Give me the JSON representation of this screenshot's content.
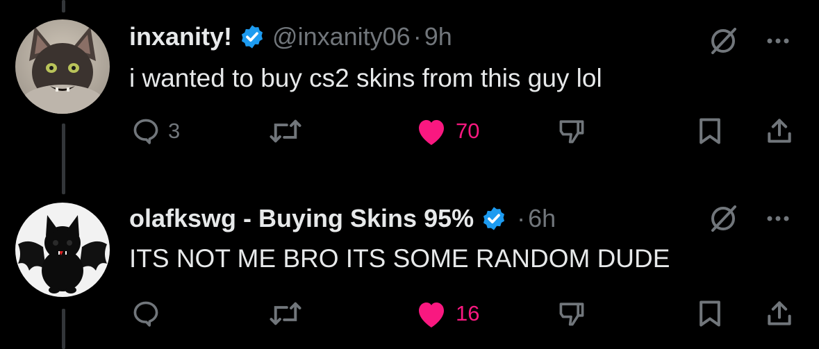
{
  "posts": [
    {
      "display_name": "inxanity!",
      "verified": true,
      "handle": "@inxanity06",
      "separator": "·",
      "time": "9h",
      "text": "i wanted to buy cs2 skins from this guy lol",
      "avatar": "hairless-cat-avatar",
      "actions": {
        "reply_count": "3",
        "retweet_count": "",
        "like_count": "70",
        "liked": true
      }
    },
    {
      "display_name": "olafkswg - Buying Skins 95%",
      "verified": true,
      "handle": "",
      "separator": "·",
      "time": "6h",
      "text": "ITS NOT ME BRO ITS SOME RANDOM DUDE",
      "avatar": "black-cat-bat-wings-avatar",
      "actions": {
        "reply_count": "",
        "retweet_count": "",
        "like_count": "16",
        "liked": true
      }
    }
  ],
  "colors": {
    "background": "#000000",
    "primary_text": "#e7e9ea",
    "secondary_text": "#71767b",
    "verified_blue": "#1d9bf0",
    "like_pink": "#f91880",
    "thread_line": "#333639"
  },
  "icons": [
    "mute-slash-icon",
    "more-icon",
    "reply-icon",
    "retweet-icon",
    "heart-icon",
    "dislike-icon",
    "bookmark-icon",
    "share-icon",
    "verified-badge-icon"
  ]
}
